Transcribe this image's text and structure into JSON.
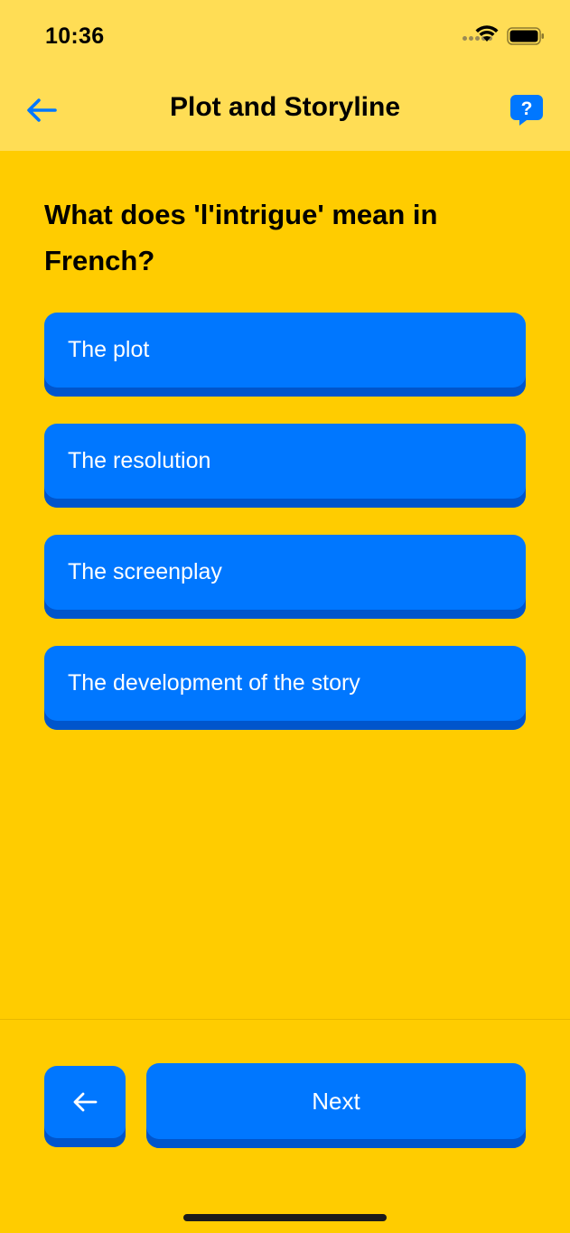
{
  "status_bar": {
    "time": "10:36",
    "icons": [
      "signal-dots-icon",
      "wifi-icon",
      "battery-icon"
    ]
  },
  "nav": {
    "back_icon": "arrow-left-icon",
    "title": "Plot and Storyline",
    "help_icon": "question-bubble-icon",
    "help_glyph": "?"
  },
  "quiz": {
    "question": "What does 'l'intrigue' mean in French?",
    "options": [
      {
        "label": "The plot"
      },
      {
        "label": "The resolution"
      },
      {
        "label": "The screenplay"
      },
      {
        "label": "The development of the story"
      }
    ]
  },
  "footer": {
    "prev_icon": "arrow-left-icon",
    "next_label": "Next"
  },
  "colors": {
    "background": "#FFCC00",
    "header": "#FFDD55",
    "accent": "#0077FF",
    "accent_shadow": "#0055CC"
  }
}
